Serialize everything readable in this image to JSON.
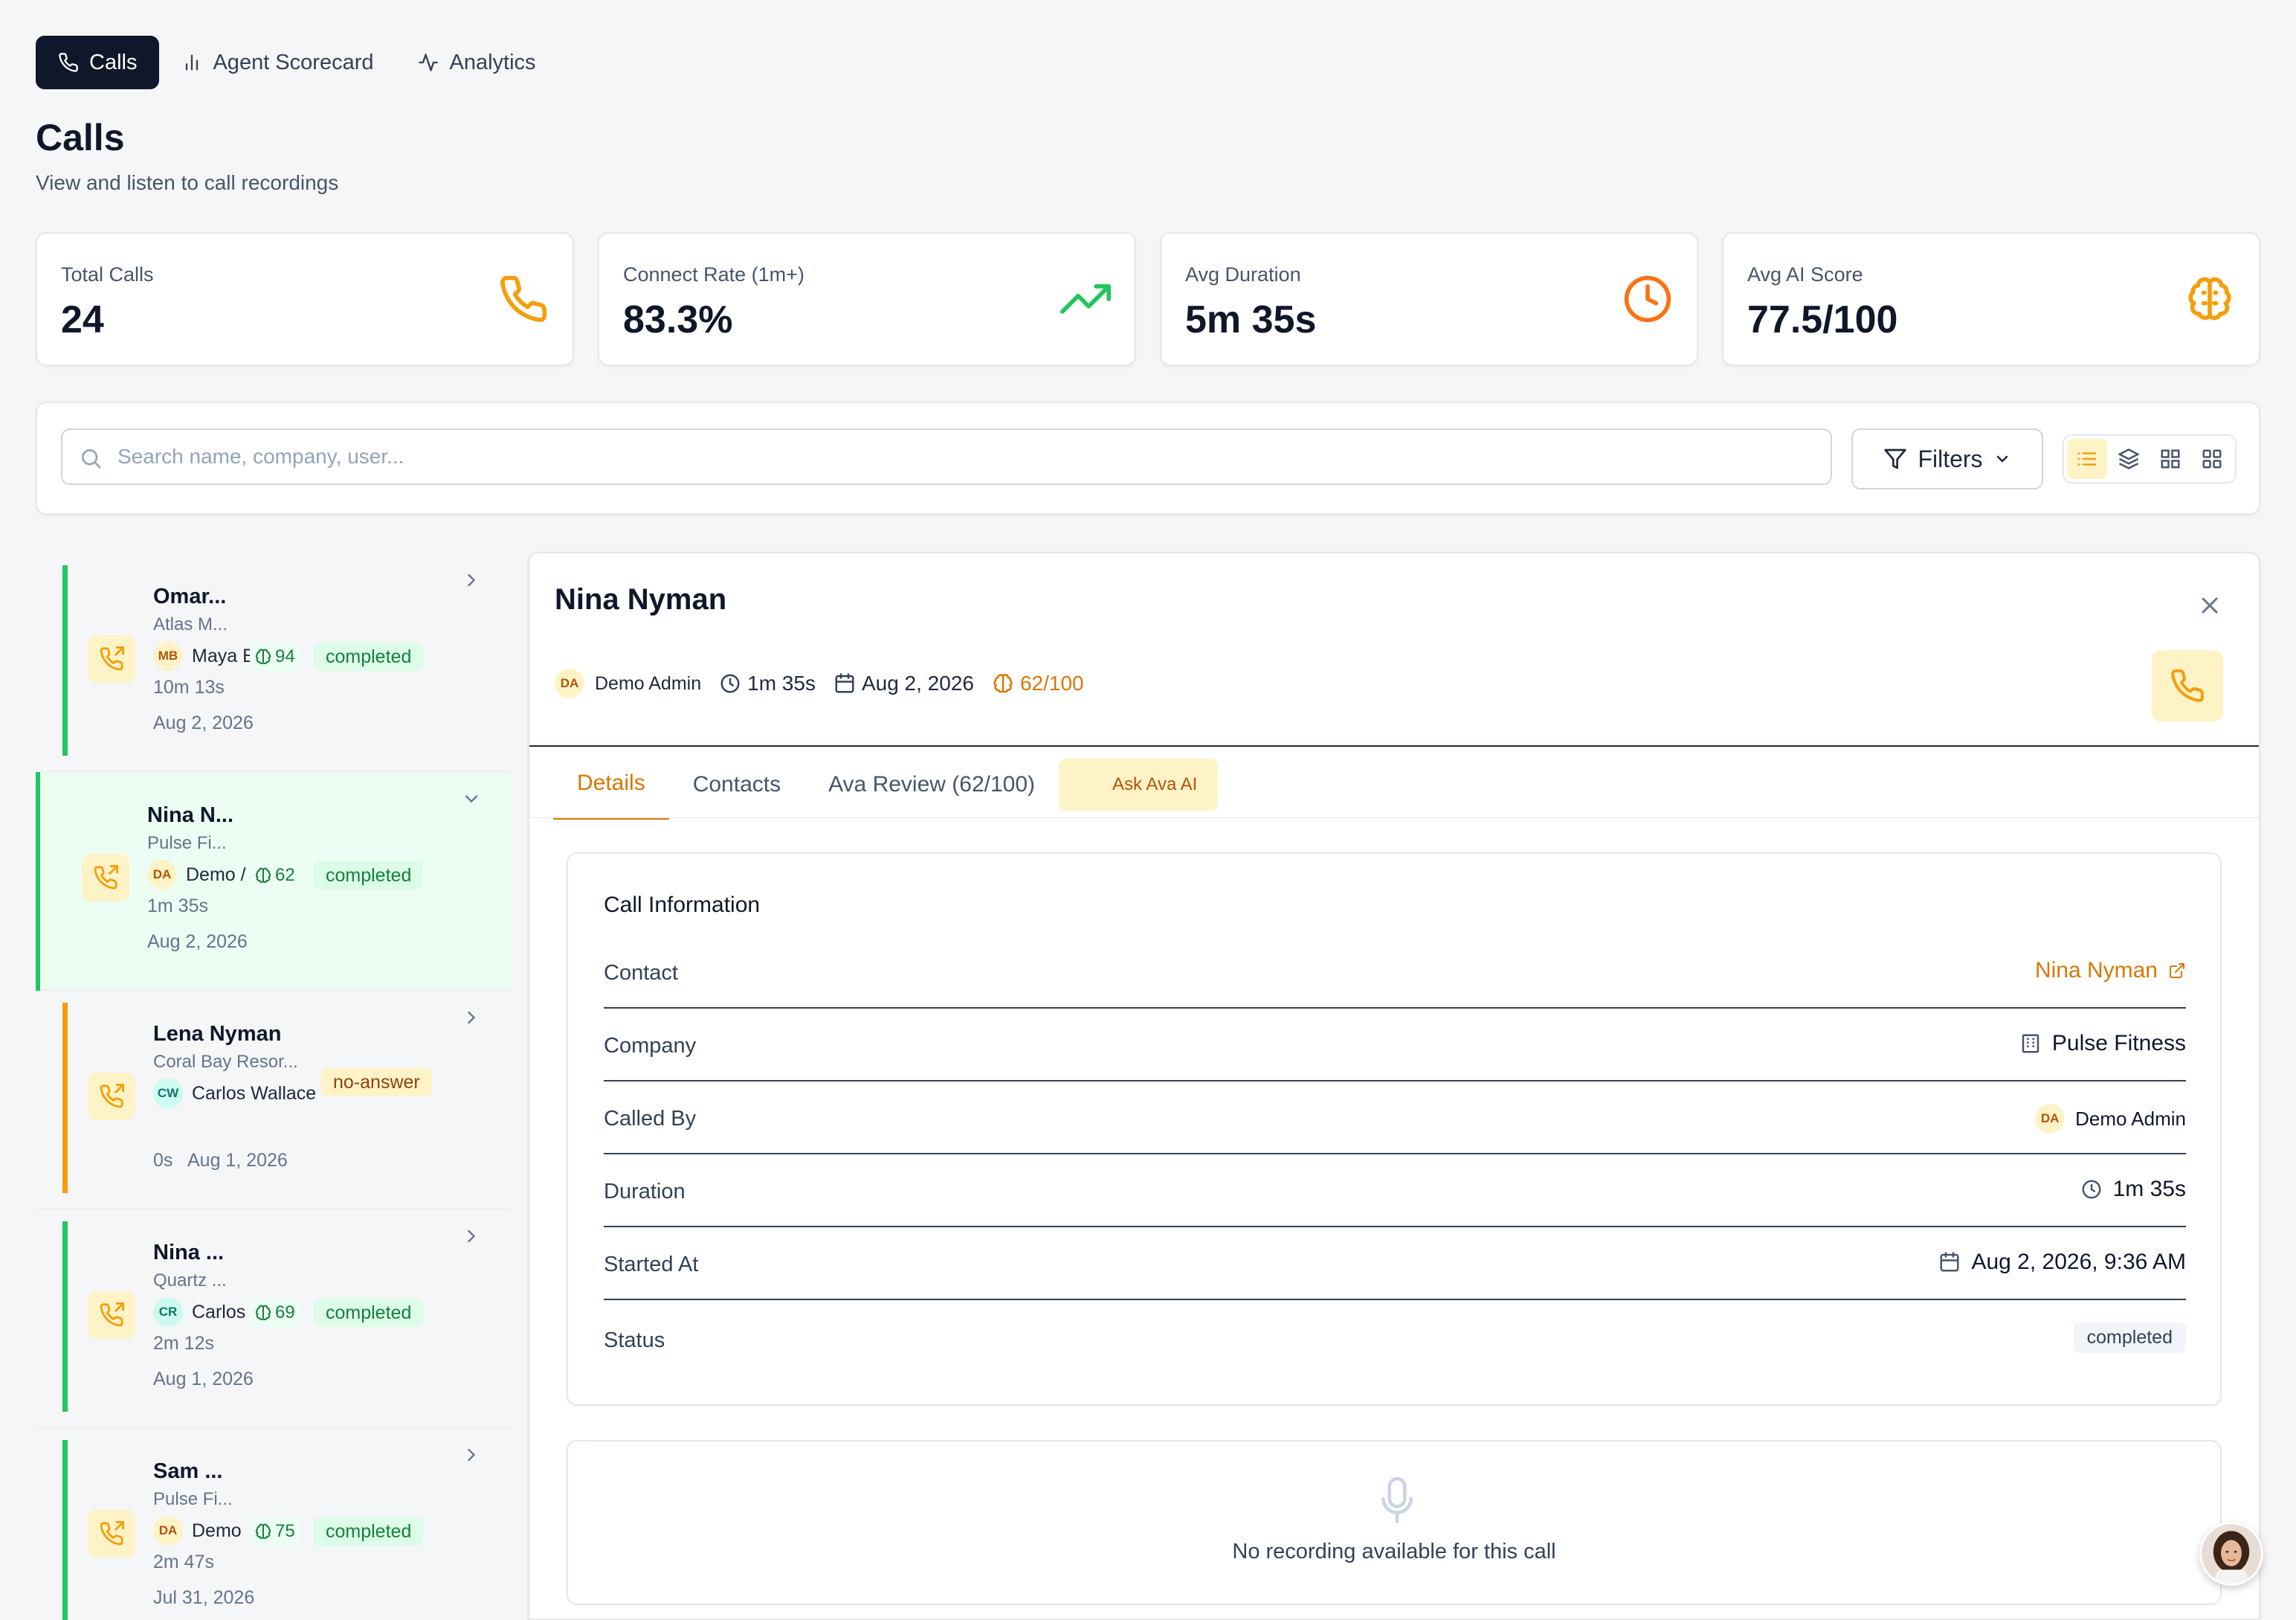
{
  "nav": {
    "tabs": [
      {
        "label": "Calls",
        "icon": "phone-icon",
        "active": true
      },
      {
        "label": "Agent Scorecard",
        "icon": "bar-chart-icon",
        "active": false
      },
      {
        "label": "Analytics",
        "icon": "activity-icon",
        "active": false
      }
    ]
  },
  "header": {
    "title": "Calls",
    "subtitle": "View and listen to call recordings"
  },
  "stats": [
    {
      "label": "Total Calls",
      "value": "24",
      "icon": "phone-icon",
      "color": "#f59e0b"
    },
    {
      "label": "Connect Rate (1m+)",
      "value": "83.3%",
      "icon": "trending-up-icon",
      "color": "#22c55e"
    },
    {
      "label": "Avg Duration",
      "value": "5m 35s",
      "icon": "clock-icon",
      "color": "#f97316"
    },
    {
      "label": "Avg AI Score",
      "value": "77.5/100",
      "icon": "brain-icon",
      "color": "#f59e0b"
    }
  ],
  "toolbar": {
    "search_placeholder": "Search name, company, user...",
    "search_value": "",
    "filters_label": "Filters",
    "view_modes": [
      "list-icon",
      "layers-icon",
      "grid-icon",
      "grid-alt-icon"
    ],
    "active_view": "list-icon"
  },
  "calls": [
    {
      "name": "Omar...",
      "company": "Atlas M...",
      "agent_initials": "MB",
      "agent": "Maya E",
      "score": "94",
      "status": "completed",
      "duration": "10m 13s",
      "date": "Aug 2, 2026",
      "selected": false
    },
    {
      "name": "Nina N...",
      "company": "Pulse Fi...",
      "agent_initials": "DA",
      "agent": "Demo /",
      "score": "62",
      "status": "completed",
      "duration": "1m 35s",
      "date": "Aug 2, 2026",
      "selected": true
    },
    {
      "name": "Lena Nyman",
      "company": "Coral Bay Resor...",
      "agent_initials": "CW",
      "agent": "Carlos Wallace",
      "score": "",
      "status": "no-answer",
      "duration": "0s",
      "date": "Aug 1, 2026",
      "selected": false
    },
    {
      "name": "Nina ...",
      "company": "Quartz ...",
      "agent_initials": "CR",
      "agent": "Carlos",
      "score": "69",
      "status": "completed",
      "duration": "2m 12s",
      "date": "Aug 1, 2026",
      "selected": false
    },
    {
      "name": "Sam ...",
      "company": "Pulse Fi...",
      "agent_initials": "DA",
      "agent": "Demo",
      "score": "75",
      "status": "completed",
      "duration": "2m 47s",
      "date": "Jul 31, 2026",
      "selected": false
    }
  ],
  "detail": {
    "title": "Nina Nyman",
    "agent_initials": "DA",
    "agent": "Demo Admin",
    "duration": "1m 35s",
    "date": "Aug 2, 2026",
    "score": "62/100",
    "tabs": [
      {
        "label": "Details",
        "active": true
      },
      {
        "label": "Contacts",
        "active": false
      },
      {
        "label": "Ava Review (62/100)",
        "active": false
      },
      {
        "label": "Ask Ava AI",
        "active": false
      }
    ],
    "info_title": "Call Information",
    "rows": {
      "contact": {
        "label": "Contact",
        "value": "Nina Nyman"
      },
      "company": {
        "label": "Company",
        "value": "Pulse Fitness"
      },
      "called_by": {
        "label": "Called By",
        "value": "Demo Admin",
        "initials": "DA"
      },
      "duration": {
        "label": "Duration",
        "value": "1m 35s"
      },
      "started_at": {
        "label": "Started At",
        "value": "Aug 2, 2026, 9:36 AM"
      },
      "status": {
        "label": "Status",
        "value": "completed"
      }
    },
    "recording_text": "No recording available for this call"
  }
}
